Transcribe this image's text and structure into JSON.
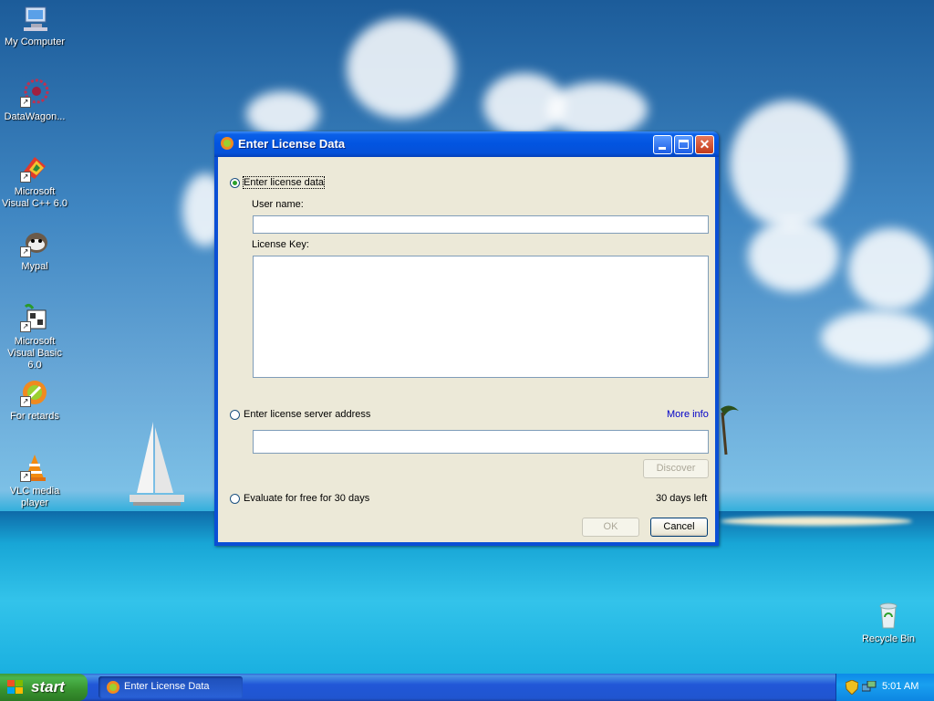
{
  "desktop": {
    "icons": [
      {
        "label": "My Computer",
        "icon": "my-computer-icon"
      },
      {
        "label": "DataWagon...",
        "icon": "datawagon-icon"
      },
      {
        "label": "Microsoft Visual C++ 6.0",
        "icon": "visual-cpp-icon"
      },
      {
        "label": "Mypal",
        "icon": "mypal-icon"
      },
      {
        "label": "Microsoft Visual Basic 6.0",
        "icon": "visual-basic-icon"
      },
      {
        "label": "For retards",
        "icon": "jetbrains-icon"
      },
      {
        "label": "VLC media player",
        "icon": "vlc-icon"
      }
    ],
    "recycle_bin": {
      "label": "Recycle Bin",
      "icon": "recycle-bin-icon"
    }
  },
  "dialog": {
    "title": "Enter License Data",
    "options": {
      "license_data_label": "Enter license data",
      "user_name_label": "User name:",
      "user_name_value": "",
      "license_key_label": "License Key:",
      "license_key_value": "",
      "server_label": "Enter license server address",
      "more_info": "More info",
      "server_value": "",
      "discover": "Discover",
      "evaluate_label": "Evaluate for free for 30 days",
      "days_left": "30 days left"
    },
    "selected_option": "license_data",
    "buttons": {
      "ok": "OK",
      "cancel": "Cancel"
    }
  },
  "taskbar": {
    "start": "start",
    "tasks": [
      {
        "label": "Enter License Data"
      }
    ],
    "clock": "5:01 AM"
  },
  "colors": {
    "titlebar": "#0254e0",
    "dialog_bg": "#ece9d8",
    "link": "#0000c8",
    "start_green": "#37922f"
  }
}
